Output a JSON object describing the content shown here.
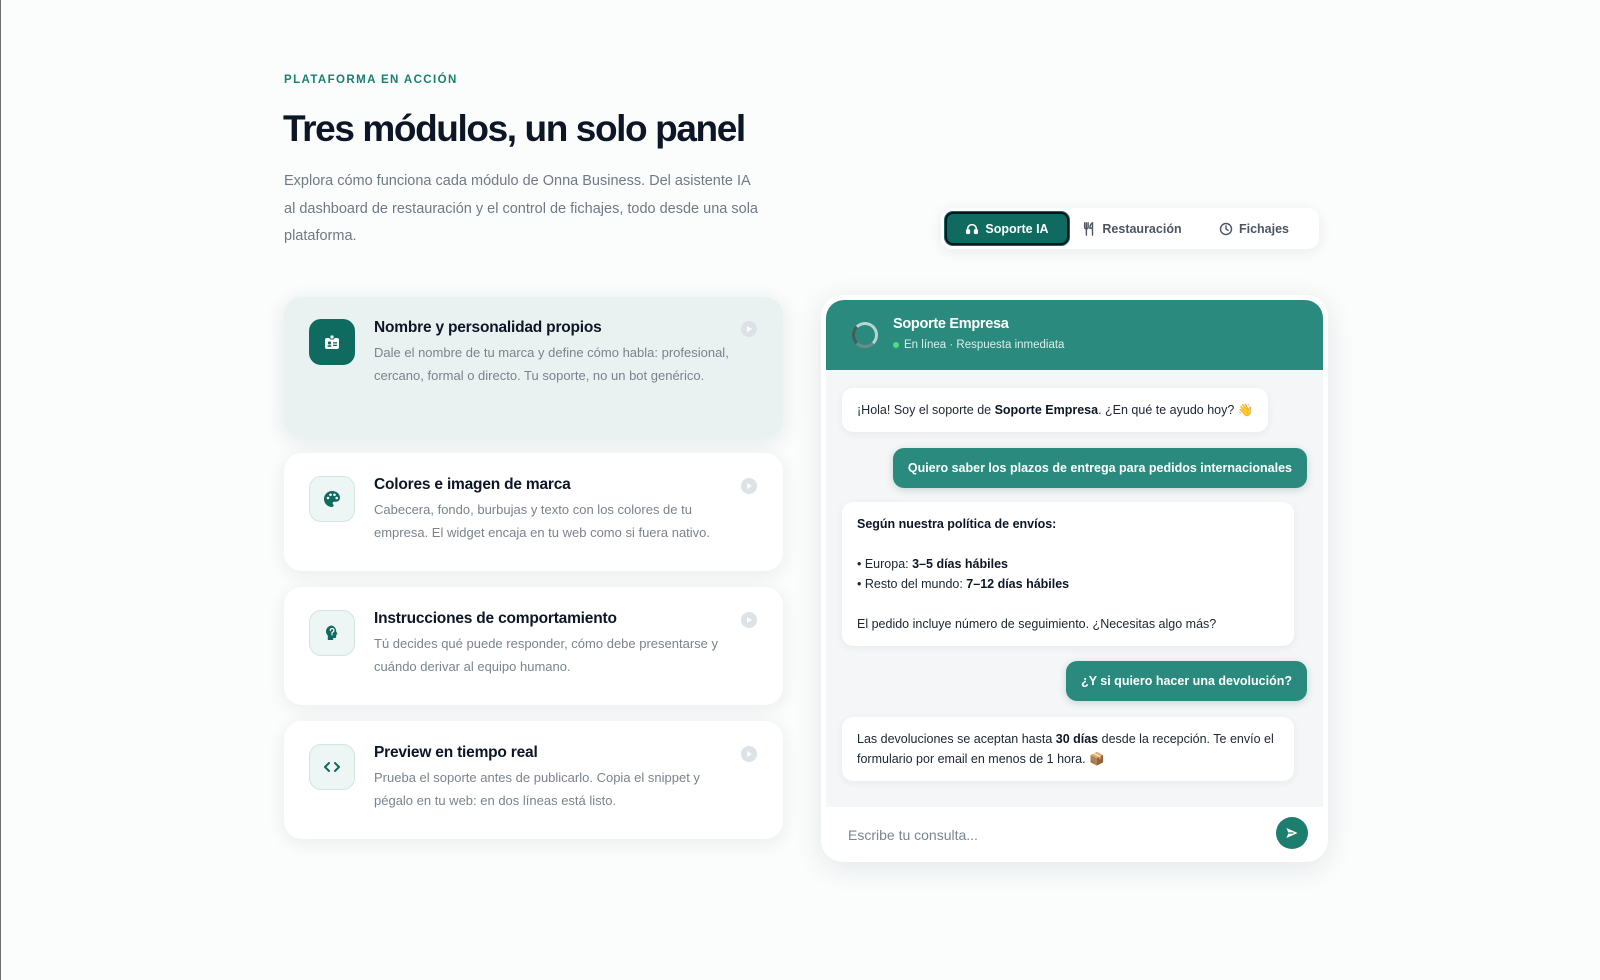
{
  "header": {
    "eyebrow": "PLATAFORMA EN ACCIÓN",
    "title": "Tres módulos, un solo panel",
    "subtitle": "Explora cómo funciona cada módulo de Onna Business. Del asistente IA al dashboard de restauración y el control de fichajes, todo desde una sola plataforma."
  },
  "tabs": [
    {
      "label": "Soporte IA",
      "icon": "headset-icon",
      "active": true
    },
    {
      "label": "Restauración",
      "icon": "utensils-icon",
      "active": false
    },
    {
      "label": "Fichajes",
      "icon": "clock-icon",
      "active": false
    }
  ],
  "features": [
    {
      "title": "Nombre y personalidad propios",
      "description": "Dale el nombre de tu marca y define cómo habla: profesional, cercano, formal o directo. Tu soporte, no un bot genérico.",
      "icon": "id-card-icon",
      "active": true
    },
    {
      "title": "Colores e imagen de marca",
      "description": "Cabecera, fondo, burbujas y texto con los colores de tu empresa. El widget encaja en tu web como si fuera nativo.",
      "icon": "palette-icon",
      "active": false
    },
    {
      "title": "Instrucciones de comportamiento",
      "description": "Tú decides qué puede responder, cómo debe presentarse y cuándo derivar al equipo humano.",
      "icon": "head-question-icon",
      "active": false
    },
    {
      "title": "Preview en tiempo real",
      "description": "Prueba el soporte antes de publicarlo. Copia el snippet y pégalo en tu web: en dos líneas está listo.",
      "icon": "code-icon",
      "active": false
    }
  ],
  "chat": {
    "name": "Soporte Empresa",
    "status": "En línea · Respuesta inmediata",
    "messages": {
      "m1_pre": "¡Hola! Soy el soporte de ",
      "m1_bold": "Soporte Empresa",
      "m1_post": ". ¿En qué te ayudo hoy? 👋",
      "m2": "Quiero saber los plazos de entrega para pedidos internacionales",
      "m3_head": "Según nuestra política de envíos:",
      "m3_l1_pre": "• Europa: ",
      "m3_l1_bold": "3–5 días hábiles",
      "m3_l2_pre": "• Resto del mundo: ",
      "m3_l2_bold": "7–12 días hábiles",
      "m3_foot": "El pedido incluye número de seguimiento. ¿Necesitas algo más?",
      "m4": "¿Y si quiero hacer una devolución?",
      "m5_pre": "Las devoluciones se aceptan hasta ",
      "m5_bold": "30 días",
      "m5_post": " desde la recepción. Te envío el formulario por email en menos de 1 hora. 📦"
    },
    "input_placeholder": "Escribe tu consulta..."
  },
  "colors": {
    "accent": "#0f6b5f",
    "chat_header": "#2a8a7e",
    "online": "#4ade80"
  }
}
